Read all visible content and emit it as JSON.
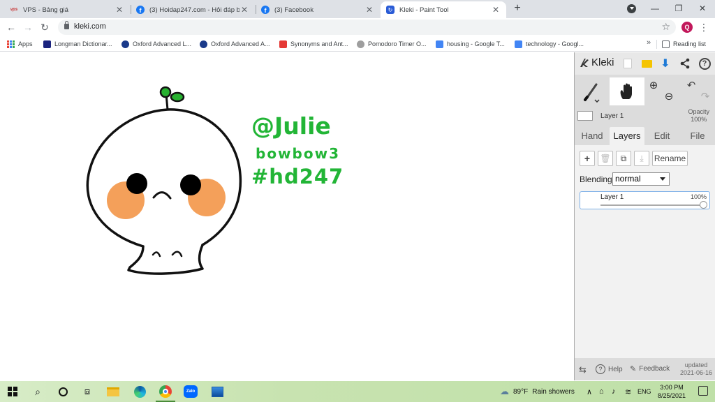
{
  "browser": {
    "tabs": [
      {
        "title": "VPS - Bảng giá",
        "favicon": "vps-icon"
      },
      {
        "title": "(3) Hoidap247.com - Hỏi đáp bài",
        "favicon": "facebook-icon"
      },
      {
        "title": "(3) Facebook",
        "favicon": "facebook-icon"
      },
      {
        "title": "Kleki - Paint Tool",
        "favicon": "kleki-icon",
        "active": true
      }
    ],
    "url": "kleki.com",
    "profile_initial": "Q",
    "bookmarks": [
      {
        "label": "Apps",
        "icon": "apps-grid-icon"
      },
      {
        "label": "Longman Dictionar...",
        "icon": "longman-icon"
      },
      {
        "label": "Oxford Advanced L...",
        "icon": "oxford-icon"
      },
      {
        "label": "Oxford Advanced A...",
        "icon": "oxford-icon"
      },
      {
        "label": "Synonyms and Ant...",
        "icon": "synonyms-icon"
      },
      {
        "label": "Pomodoro Timer O...",
        "icon": "timer-icon"
      },
      {
        "label": "housing - Google T...",
        "icon": "google-docs-icon"
      },
      {
        "label": "technology - Googl...",
        "icon": "google-docs-icon"
      }
    ],
    "more_label": "»",
    "reading_list": "Reading list"
  },
  "canvas": {
    "handle": "@Julie",
    "line2": "bowbow3",
    "line3": "#hd247",
    "ink_color": "#22b536",
    "cheek_color": "#f4a05a"
  },
  "kleki": {
    "logo": "Kleki",
    "layer_label": "Layer 1",
    "opacity_label": "Opacity",
    "opacity_value": "100%",
    "tabs": [
      {
        "label": "Hand"
      },
      {
        "label": "Layers",
        "active": true
      },
      {
        "label": "Edit"
      },
      {
        "label": "File"
      }
    ],
    "rename_label": "Rename",
    "blending_label": "Blending",
    "blending_value": "normal",
    "layer_row": {
      "name": "Layer 1",
      "opacity": "100%",
      "opacity_fraction": 1.0
    },
    "footer": {
      "help": "Help",
      "feedback": "Feedback",
      "updated_label": "updated",
      "updated_date": "2021-06-16"
    }
  },
  "taskbar": {
    "weather_temp": "89°F",
    "weather_text": "Rain showers",
    "language": "ENG",
    "time": "3:00 PM",
    "date": "8/25/2021"
  }
}
